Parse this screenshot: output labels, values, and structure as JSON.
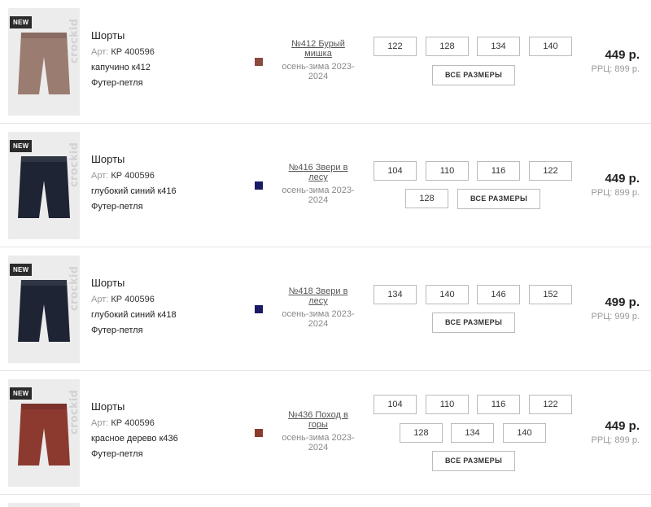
{
  "products": [
    {
      "badge": "NEW",
      "brand": "crockid",
      "title": "Шорты",
      "art_label": "Арт:",
      "art_code": "КР 400596",
      "color_name": "капучино к412",
      "fabric": "Футер-петля",
      "swatch": "#8b4a3c",
      "collection_link": "№412 Бурый мишка",
      "season": "осень-зима 2023-2024",
      "sizes": [
        "122",
        "128",
        "134",
        "140"
      ],
      "all_sizes": "ВСЕ РАЗМЕРЫ",
      "price": "449 р.",
      "rrc": "РРЦ: 899 р.",
      "garment_color": "#9b7c71"
    },
    {
      "badge": "NEW",
      "brand": "crockid",
      "title": "Шорты",
      "art_label": "Арт:",
      "art_code": "КР 400596",
      "color_name": "глубокий синий к416",
      "fabric": "Футер-петля",
      "swatch": "#1a1a66",
      "collection_link": "№416 Звери в лесу",
      "season": "осень-зима 2023-2024",
      "sizes": [
        "104",
        "110",
        "116",
        "122",
        "128"
      ],
      "all_sizes": "ВСЕ РАЗМЕРЫ",
      "price": "449 р.",
      "rrc": "РРЦ: 899 р.",
      "garment_color": "#1e2434"
    },
    {
      "badge": "NEW",
      "brand": "crockid",
      "title": "Шорты",
      "art_label": "Арт:",
      "art_code": "КР 400596",
      "color_name": "глубокий синий к418",
      "fabric": "Футер-петля",
      "swatch": "#1a1a66",
      "collection_link": "№418 Звери в лесу",
      "season": "осень-зима 2023-2024",
      "sizes": [
        "134",
        "140",
        "146",
        "152"
      ],
      "all_sizes": "ВСЕ РАЗМЕРЫ",
      "price": "499 р.",
      "rrc": "РРЦ: 999 р.",
      "garment_color": "#1e2434"
    },
    {
      "badge": "NEW",
      "brand": "crockid",
      "title": "Шорты",
      "art_label": "Арт:",
      "art_code": "КР 400596",
      "color_name": "красное дерево к436",
      "fabric": "Футер-петля",
      "swatch": "#8b3a30",
      "collection_link": "№436 Поход в горы",
      "season": "осень-зима 2023-2024",
      "sizes": [
        "104",
        "110",
        "116",
        "122",
        "128",
        "134",
        "140"
      ],
      "all_sizes": "ВСЕ РАЗМЕРЫ",
      "price": "449 р.",
      "rrc": "РРЦ: 899 р.",
      "garment_color": "#8c3a30"
    }
  ]
}
